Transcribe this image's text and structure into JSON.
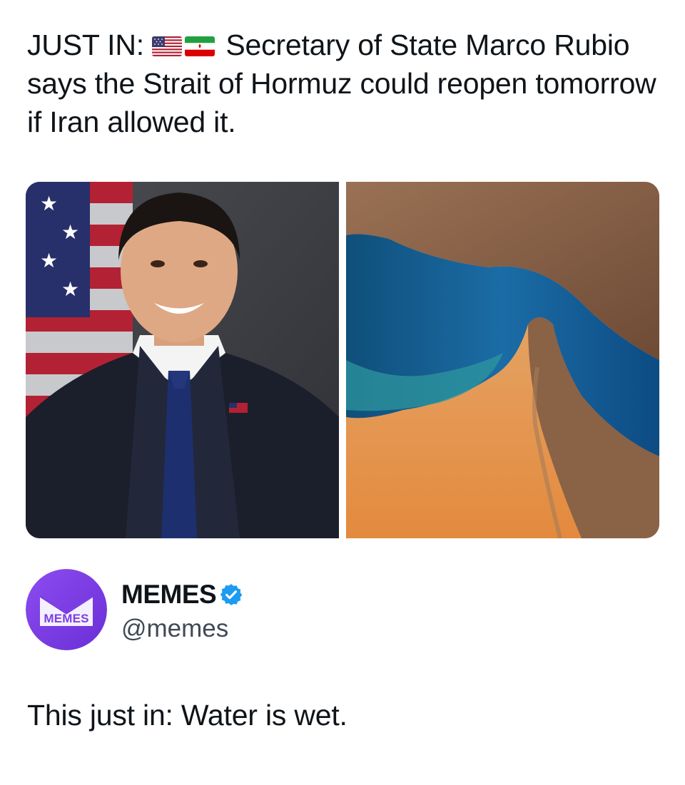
{
  "post": {
    "prefix": "JUST IN:",
    "flags": [
      "us-flag-icon",
      "iran-flag-icon"
    ],
    "text_line1": "Secretary of State Marco Rubio",
    "text_rest": "says the Strait of Hormuz could reopen tomorrow if Iran allowed it."
  },
  "media": {
    "images": [
      "portrait-photo",
      "strait-satellite-photo"
    ]
  },
  "quote": {
    "avatar_label": "MEMES",
    "display_name": "MEMES",
    "verified_icon": "verified-badge-icon",
    "handle": "@memes"
  },
  "reply": {
    "text": "This just in: Water is wet."
  },
  "colors": {
    "verified_blue": "#1d9bf0",
    "avatar_purple": "#7b3fe4",
    "text": "#0f1419"
  }
}
